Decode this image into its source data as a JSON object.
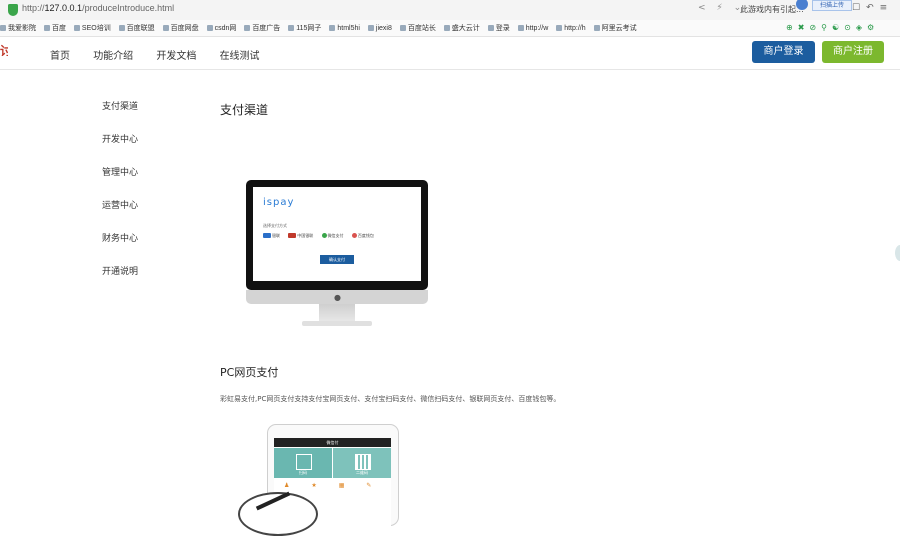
{
  "browser": {
    "url_prefix": "http://",
    "url_host": "127.0.0.1",
    "url_path": "/produceIntroduce.html",
    "game_text": "此游戏内有引起...",
    "upload_label": "扫描上传",
    "bookmarks": [
      "我爱影院",
      "百度",
      "SEO培训",
      "百度联盟",
      "百度网盘",
      "csdn网",
      "百度广告",
      "115网子",
      "html5hi",
      "jiexi8",
      "百度站长",
      "盛大云计",
      "登录",
      "http://w",
      "http://h",
      "阿里云考试"
    ]
  },
  "header": {
    "logo": "讨",
    "nav": [
      "首页",
      "功能介绍",
      "开发文档",
      "在线测试"
    ],
    "login_label": "商户登录",
    "register_label": "商户注册",
    "login_color": "#1c5d9f",
    "register_color": "#7cb82e"
  },
  "sidebar": {
    "items": [
      "支付渠道",
      "开发中心",
      "管理中心",
      "运营中心",
      "财务中心",
      "开通说明"
    ]
  },
  "main": {
    "title": "支付渠道",
    "monitor": {
      "brand": "ispay",
      "select_label": "选择支付方式",
      "methods": [
        "银联",
        "中国银联",
        "微信支付",
        "百度钱包"
      ],
      "confirm_label": "确认支付"
    },
    "pc_title": "PC网页支付",
    "pc_desc": "彩虹易支付,PC网页支付支持支付宝网页支付、支付宝扫码支付、微信扫码支付、银联网页支付、百度钱包等。",
    "tablet": {
      "bar_title": "微信付",
      "tiles": [
        "扫码",
        "二维码"
      ]
    }
  }
}
